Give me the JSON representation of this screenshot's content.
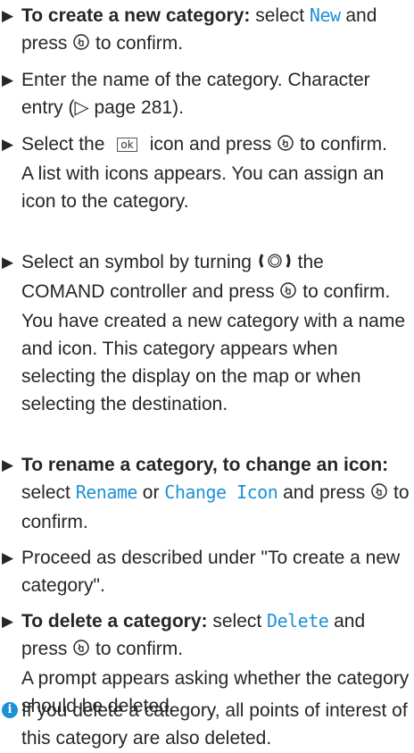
{
  "steps": [
    {
      "lead": "To create a new category:",
      "t1": " select ",
      "k1": "New",
      "t2": " and press ",
      "t3": " to confirm."
    },
    {
      "t1": "Enter the name of the category. Character entry (▷ page 281)."
    },
    {
      "t1": "Select the",
      "ok": "ok",
      "t2": "icon and press ",
      "t3": " to confirm.",
      "note": "A list with icons appears. You can assign an icon to the category."
    },
    {
      "t1": "Select an symbol by turning ",
      "t2": " the COMAND controller and press ",
      "t3": " to confirm.",
      "note": "You have created a new category with a name and icon. This category appears when selecting the display on the map or when selecting the destination."
    },
    {
      "lead": "To rename a category, to change an icon:",
      "t1": " select ",
      "k1": "Rename",
      "t2": " or ",
      "k2": "Change Icon",
      "t3": " and press ",
      "t4": " to confirm."
    },
    {
      "t1": "Proceed as described under \"To create a new category\"."
    },
    {
      "lead": "To delete a category:",
      "t1": " select ",
      "k1": "Delete",
      "t2": " and press ",
      "t3": " to confirm.",
      "note": "A prompt appears asking whether the category should be deleted."
    }
  ],
  "info": {
    "icon": "i",
    "text": "If you delete a category, all points of interest of this category are also deleted."
  },
  "colors": {
    "accent": "#1e90d6",
    "text": "#262626"
  },
  "icons": [
    "bullet-triangle-icon",
    "press-controller-icon",
    "turn-controller-icon",
    "ok-icon",
    "info-icon"
  ]
}
